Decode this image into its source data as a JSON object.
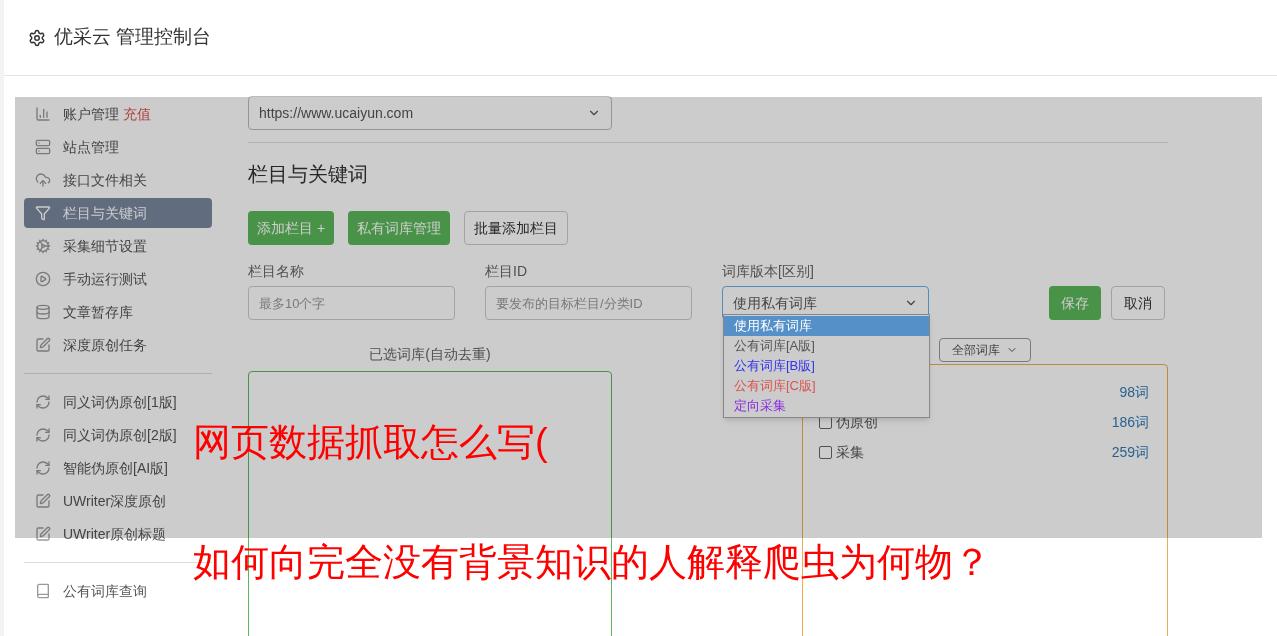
{
  "header": {
    "title": "优采云 管理控制台"
  },
  "sidebar": {
    "groups": [
      [
        {
          "label": "账户管理",
          "badge": "充值",
          "selected": false
        },
        {
          "label": "站点管理",
          "selected": false
        },
        {
          "label": "接口文件相关",
          "selected": false
        },
        {
          "label": "栏目与关键词",
          "selected": true
        },
        {
          "label": "采集细节设置",
          "selected": false
        },
        {
          "label": "手动运行测试",
          "selected": false
        },
        {
          "label": "文章暂存库",
          "selected": false
        },
        {
          "label": "深度原创任务",
          "selected": false
        }
      ],
      [
        {
          "label": "同义词伪原创[1版]",
          "selected": false
        },
        {
          "label": "同义词伪原创[2版]",
          "selected": false
        },
        {
          "label": "智能伪原创[AI版]",
          "selected": false
        },
        {
          "label": "UWriter深度原创",
          "selected": false
        },
        {
          "label": "UWriter原创标题",
          "selected": false
        }
      ],
      [
        {
          "label": "公有词库查询",
          "selected": false
        }
      ]
    ]
  },
  "site_select": {
    "value": "https://www.ucaiyun.com"
  },
  "section_title": "栏目与关键词",
  "actions": [
    {
      "label": "添加栏目 +",
      "kind": "primary"
    },
    {
      "label": "私有词库管理",
      "kind": "primary"
    },
    {
      "label": "批量添加栏目",
      "kind": "default"
    }
  ],
  "form": {
    "name_field": {
      "label": "栏目名称",
      "placeholder": "最多10个字"
    },
    "id_field": {
      "label": "栏目ID",
      "placeholder": "要发布的目标栏目/分类ID"
    },
    "library_select": {
      "label": "词库版本[区别]",
      "value": "使用私有词库",
      "options": [
        {
          "label": "使用私有词库",
          "selected": true
        },
        {
          "label": "公有词库[A版]",
          "selected": false,
          "color": "#555555"
        },
        {
          "label": "公有词库[B版]",
          "selected": false,
          "color": "#3333ee"
        },
        {
          "label": "公有词库[C版]",
          "selected": false,
          "color": "#d9534f"
        },
        {
          "label": "定向采集",
          "selected": false,
          "color": "#8a2be2"
        }
      ]
    },
    "save": "保存",
    "cancel": "取消"
  },
  "selected_panel": {
    "title": "已选词库(自动去重)"
  },
  "library_panel": {
    "filter": "全部词库",
    "items": [
      {
        "count": "98词"
      },
      {
        "label": "伪原创",
        "count": "186词",
        "checked": false
      },
      {
        "label": "采集",
        "count": "259词",
        "checked": false
      }
    ]
  },
  "overlay_text": [
    "网页数据抓取怎么写(",
    "如何向完全没有背景知识的人解释爬虫为何物？"
  ]
}
